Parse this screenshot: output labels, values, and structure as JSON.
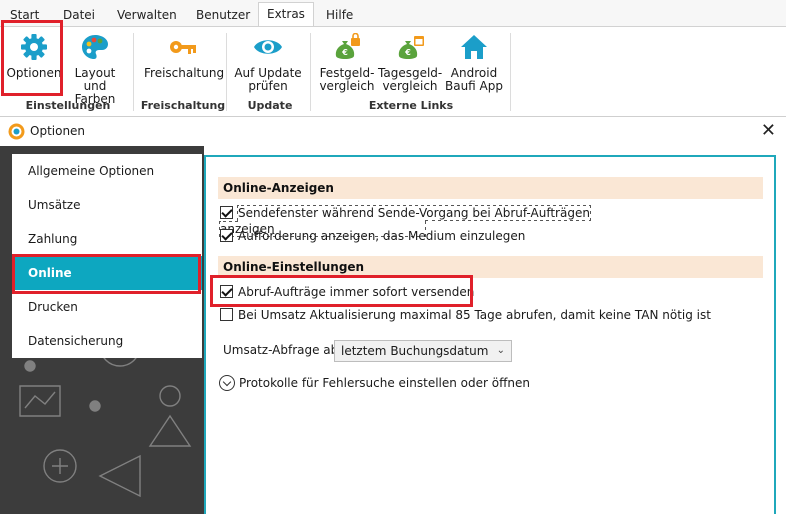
{
  "ribbon": {
    "tabs": [
      {
        "label": "Start"
      },
      {
        "label": "Datei"
      },
      {
        "label": "Verwalten"
      },
      {
        "label": "Benutzer"
      },
      {
        "label": "Extras"
      },
      {
        "label": "Hilfe"
      }
    ],
    "buttons": {
      "optionen": "Optionen",
      "layout_line1": "Layout und",
      "layout_line2": "Farben",
      "freischaltung": "Freischaltung",
      "update_line1": "Auf Update",
      "update_line2": "prüfen",
      "festgeld_line1": "Festgeld-",
      "festgeld_line2": "vergleich",
      "tagesgeld_line1": "Tagesgeld-",
      "tagesgeld_line2": "vergleich",
      "android_line1": "Android",
      "android_line2": "Baufi App"
    },
    "groups": {
      "einstellungen": "Einstellungen",
      "freischaltung": "Freischaltung",
      "update": "Update",
      "externe_links": "Externe Links"
    }
  },
  "dialog": {
    "title": "Optionen",
    "close": "✕",
    "nav": [
      {
        "label": "Allgemeine Optionen"
      },
      {
        "label": "Umsätze"
      },
      {
        "label": "Zahlung"
      },
      {
        "label": "Online"
      },
      {
        "label": "Drucken"
      },
      {
        "label": "Datensicherung"
      }
    ],
    "sections": {
      "anzeigen": "Online-Anzeigen",
      "einstellungen": "Online-Einstellungen"
    },
    "checkboxes": {
      "sendefenster": "Sendefenster während Sende-Vorgang bei Abruf-Aufträgen anzeigen",
      "aufforderung": "Aufforderung anzeigen, das Medium einzulegen",
      "abruf": "Abruf-Aufträge immer sofort versenden",
      "umsatz85": "Bei Umsatz Aktualisierung maximal 85 Tage abrufen, damit keine TAN nötig ist"
    },
    "umsatz_abfrage_label": "Umsatz-Abfrage ab",
    "umsatz_abfrage_value": "letztem Buchungsdatum",
    "protokolle": "Protokolle für Fehlersuche einstellen oder öffnen"
  },
  "colors": {
    "accent": "#0da7c0",
    "highlight_red": "#e0202a",
    "section_bg": "#fae7d5",
    "icon_blue": "#1b9ec9",
    "icon_orange": "#f29a1b",
    "icon_green": "#5aa33c"
  }
}
